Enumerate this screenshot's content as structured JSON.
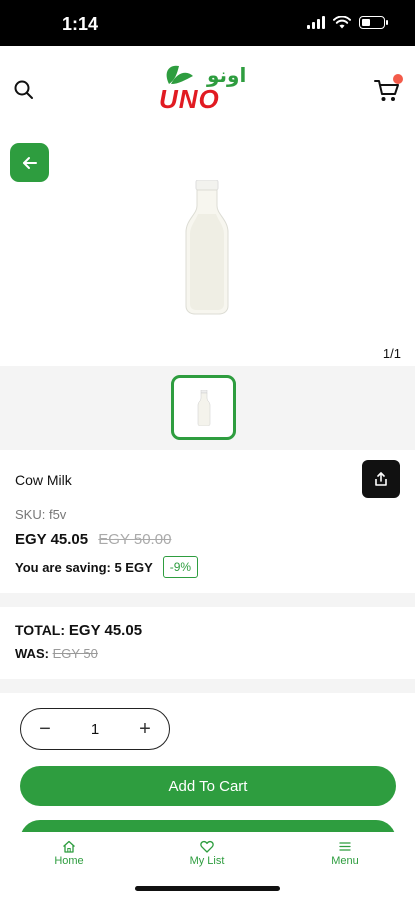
{
  "status_bar": {
    "time": "1:14"
  },
  "header": {
    "logo_latin": "UNO",
    "logo_arabic": "اونو"
  },
  "gallery": {
    "counter": "1/1"
  },
  "product": {
    "title": "Cow Milk",
    "sku": "SKU: f5v",
    "price": "EGY 45.05",
    "old_price": "EGY 50.00",
    "saving_text": "You are saving: 5 EGY",
    "discount": "-9%"
  },
  "summary": {
    "total_label": "TOTAL:",
    "total_amount": "EGY 45.05",
    "was_label": "WAS:",
    "was_amount": "EGY 50"
  },
  "quantity": {
    "value": "1",
    "minus": "−",
    "plus": "+"
  },
  "actions": {
    "add_to_cart": "Add To Cart"
  },
  "bottom_nav": {
    "items": [
      {
        "label": "Home",
        "icon": "home-icon"
      },
      {
        "label": "My List",
        "icon": "heart-icon"
      },
      {
        "label": "Menu",
        "icon": "menu-icon"
      }
    ]
  },
  "colors": {
    "brand_green": "#2e9d3f",
    "logo_red": "#e11b22",
    "badge_dot": "#f35b4a"
  }
}
